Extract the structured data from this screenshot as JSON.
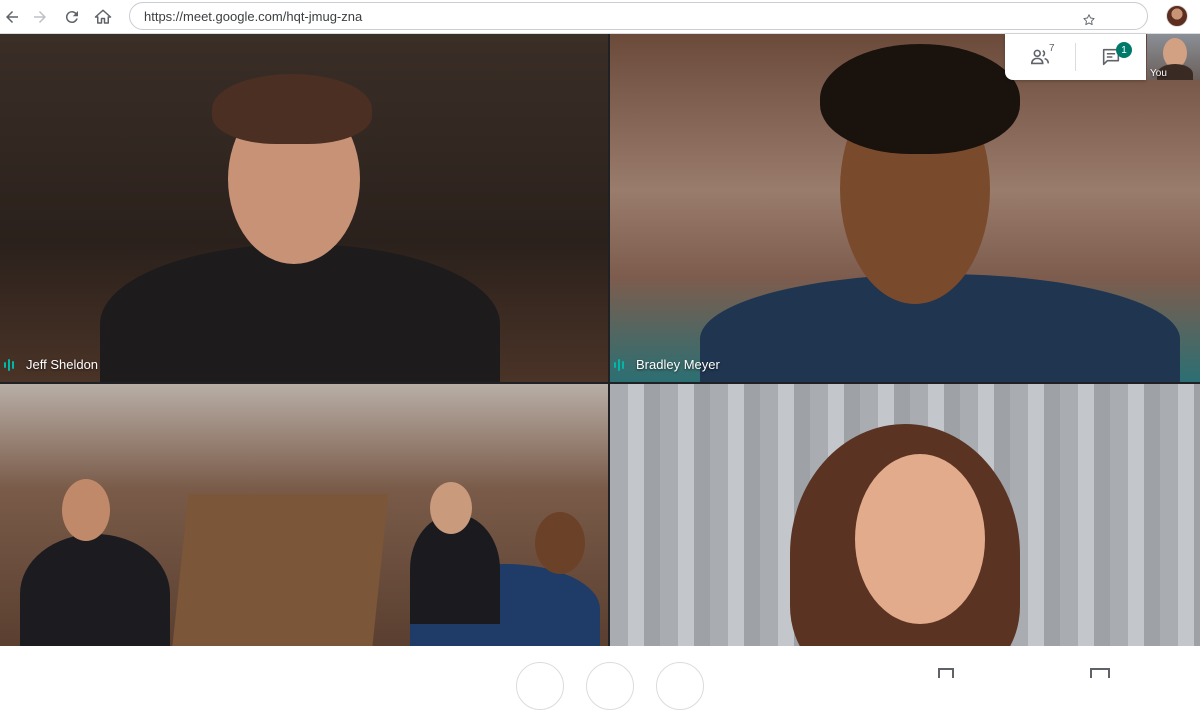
{
  "browser": {
    "url": "https://meet.google.com/hqt-jmug-zna",
    "icons": [
      "back-arrow-icon",
      "forward-arrow-icon",
      "reload-icon",
      "home-icon",
      "star-icon"
    ]
  },
  "participants": [
    {
      "name": "Jeff Sheldon",
      "speaking": true
    },
    {
      "name": "Bradley Meyer",
      "speaking": true
    },
    {
      "name": "",
      "speaking": false
    },
    {
      "name": "",
      "speaking": false
    }
  ],
  "panel": {
    "people_count": "7",
    "chat_badge": "1",
    "self_label": "You"
  },
  "colors": {
    "accent": "#00796b",
    "audio_indicator": "#00b8a9"
  }
}
